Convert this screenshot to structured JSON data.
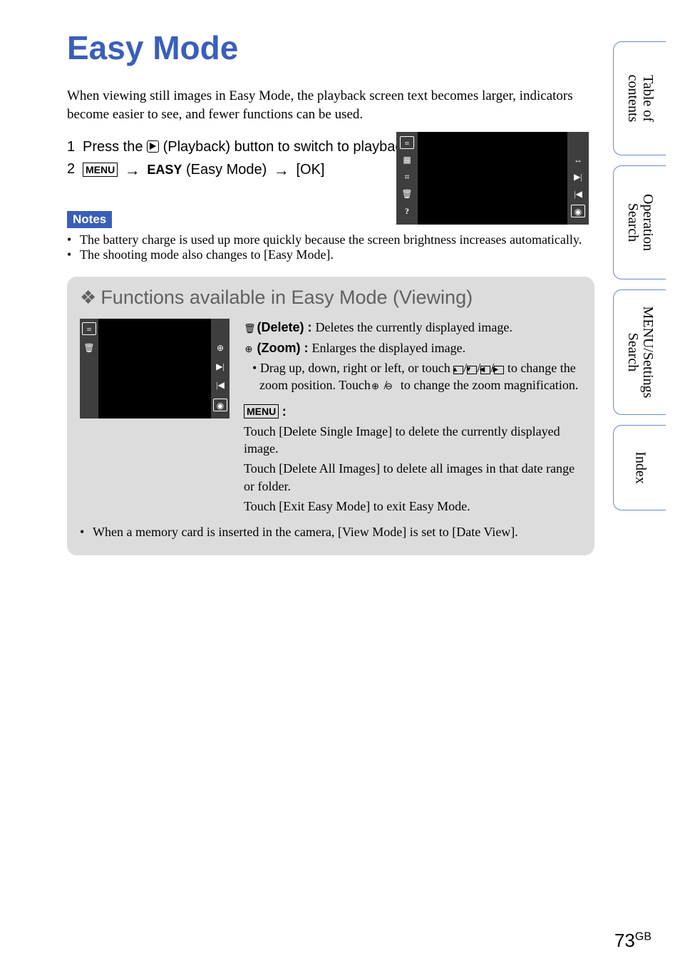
{
  "title": "Easy Mode",
  "intro": "When viewing still images in Easy Mode, the playback screen text becomes larger, indicators become easier to see, and fewer functions can be used.",
  "steps": [
    {
      "num": "1",
      "prefix": "Press the ",
      "mid": " (Playback) button to switch to playback mode."
    },
    {
      "num": "2",
      "menu": "MENU",
      "easy": "EASY",
      "tail1": " (Easy Mode) ",
      "tail2": " [OK]"
    }
  ],
  "notes_label": "Notes",
  "notes": [
    "The battery charge is used up more quickly because the screen brightness increases automatically.",
    "The shooting mode also changes to [Easy Mode]."
  ],
  "tip_title": "Functions available in Easy Mode (Viewing)",
  "tip": {
    "delete_label": " (Delete) : ",
    "delete_text": "Deletes the currently displayed image.",
    "zoom_label": " (Zoom) : ",
    "zoom_text": "Enlarges the displayed image.",
    "zoom_sub1a": "Drag up, down, right or left, or touch ",
    "zoom_sub1b": " to change the zoom position. Touch ",
    "zoom_sub1c": " to change the zoom magnification.",
    "menu_label": "MENU",
    "menu_colon": " :",
    "menu_line1": "Touch [Delete Single Image] to delete the currently displayed image.",
    "menu_line2": "Touch [Delete All Images] to delete all images in that date range or folder.",
    "menu_line3": "Touch [Exit Easy Mode] to exit Easy Mode."
  },
  "tip_bottom": "When a memory card is inserted in the camera, [View Mode] is set to [Date View].",
  "sidetabs": {
    "t1": "Table of\ncontents",
    "t2": "Operation\nSearch",
    "t3": "MENU/Settings\nSearch",
    "t4": "Index"
  },
  "page_number": "73",
  "page_suffix": "GB"
}
